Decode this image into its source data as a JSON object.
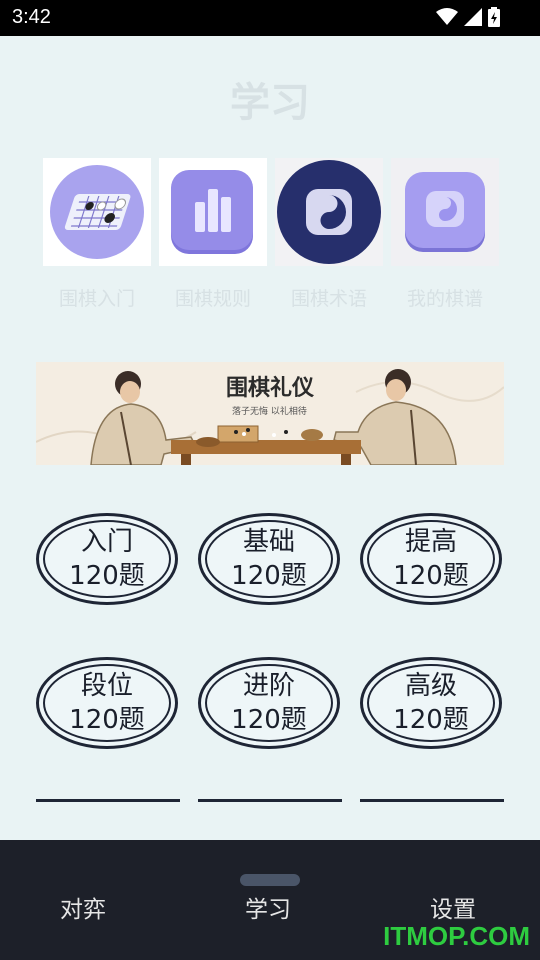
{
  "status_bar": {
    "time": "3:42"
  },
  "page": {
    "title": "学习"
  },
  "features": [
    {
      "label": "围棋入门",
      "icon": "go-board-icon"
    },
    {
      "label": "围棋规则",
      "icon": "bar-chart-icon"
    },
    {
      "label": "围棋术语",
      "icon": "badge-icon"
    },
    {
      "label": "我的棋谱",
      "icon": "record-icon"
    }
  ],
  "banner": {
    "title": "围棋礼仪",
    "subtitle": "落子无悔 以礼相待"
  },
  "levels": [
    {
      "name": "入门",
      "count": "120题"
    },
    {
      "name": "基础",
      "count": "120题"
    },
    {
      "name": "提高",
      "count": "120题"
    },
    {
      "name": "段位",
      "count": "120题"
    },
    {
      "name": "进阶",
      "count": "120题"
    },
    {
      "name": "高级",
      "count": "120题"
    }
  ],
  "nav": {
    "play": "对弈",
    "learn": "学习",
    "settings": "设置"
  },
  "watermark": "ITMOP.COM",
  "colors": {
    "accent": "#1e2535",
    "nav_bg": "#1d2029",
    "page_bg": "#e9f3f4",
    "icon_purple": "#8e84e6",
    "icon_navy": "#262f6c"
  }
}
